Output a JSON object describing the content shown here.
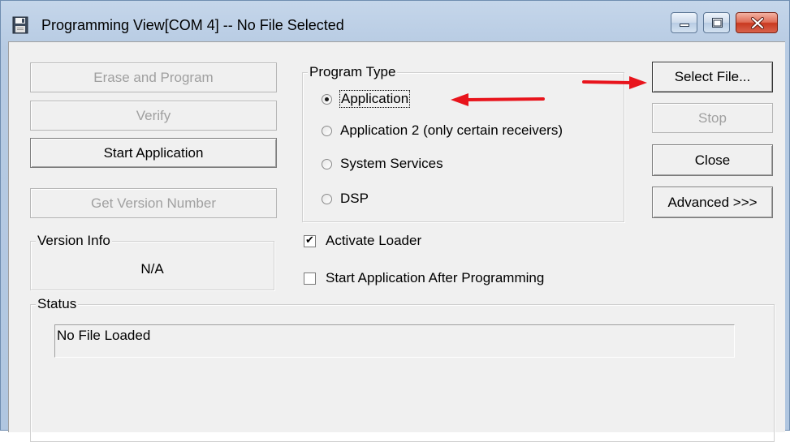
{
  "window": {
    "title": "Programming View[COM 4] -- No File Selected",
    "caption_buttons": [
      "minimize-icon",
      "maximize-icon",
      "close-icon"
    ]
  },
  "left_buttons": {
    "erase_and_program": "Erase and Program",
    "verify": "Verify",
    "start_application": "Start Application",
    "get_version_number": "Get Version Number"
  },
  "version_info": {
    "label": "Version Info",
    "value": "N/A"
  },
  "program_type": {
    "label": "Program Type",
    "options": [
      {
        "label": "Application",
        "checked": true
      },
      {
        "label": "Application 2 (only certain receivers)",
        "checked": false
      },
      {
        "label": "System Services",
        "checked": false
      },
      {
        "label": "DSP",
        "checked": false
      }
    ]
  },
  "checkboxes": {
    "activate_loader": {
      "label": "Activate Loader",
      "checked": true
    },
    "start_after_programming": {
      "label": "Start Application After Programming",
      "checked": false
    }
  },
  "right_buttons": {
    "select_file": "Select File...",
    "stop": "Stop",
    "close": "Close",
    "advanced": "Advanced >>>"
  },
  "status": {
    "label": "Status",
    "text": "No File Loaded"
  },
  "annotations": {
    "arrow_color": "#e8141c"
  }
}
